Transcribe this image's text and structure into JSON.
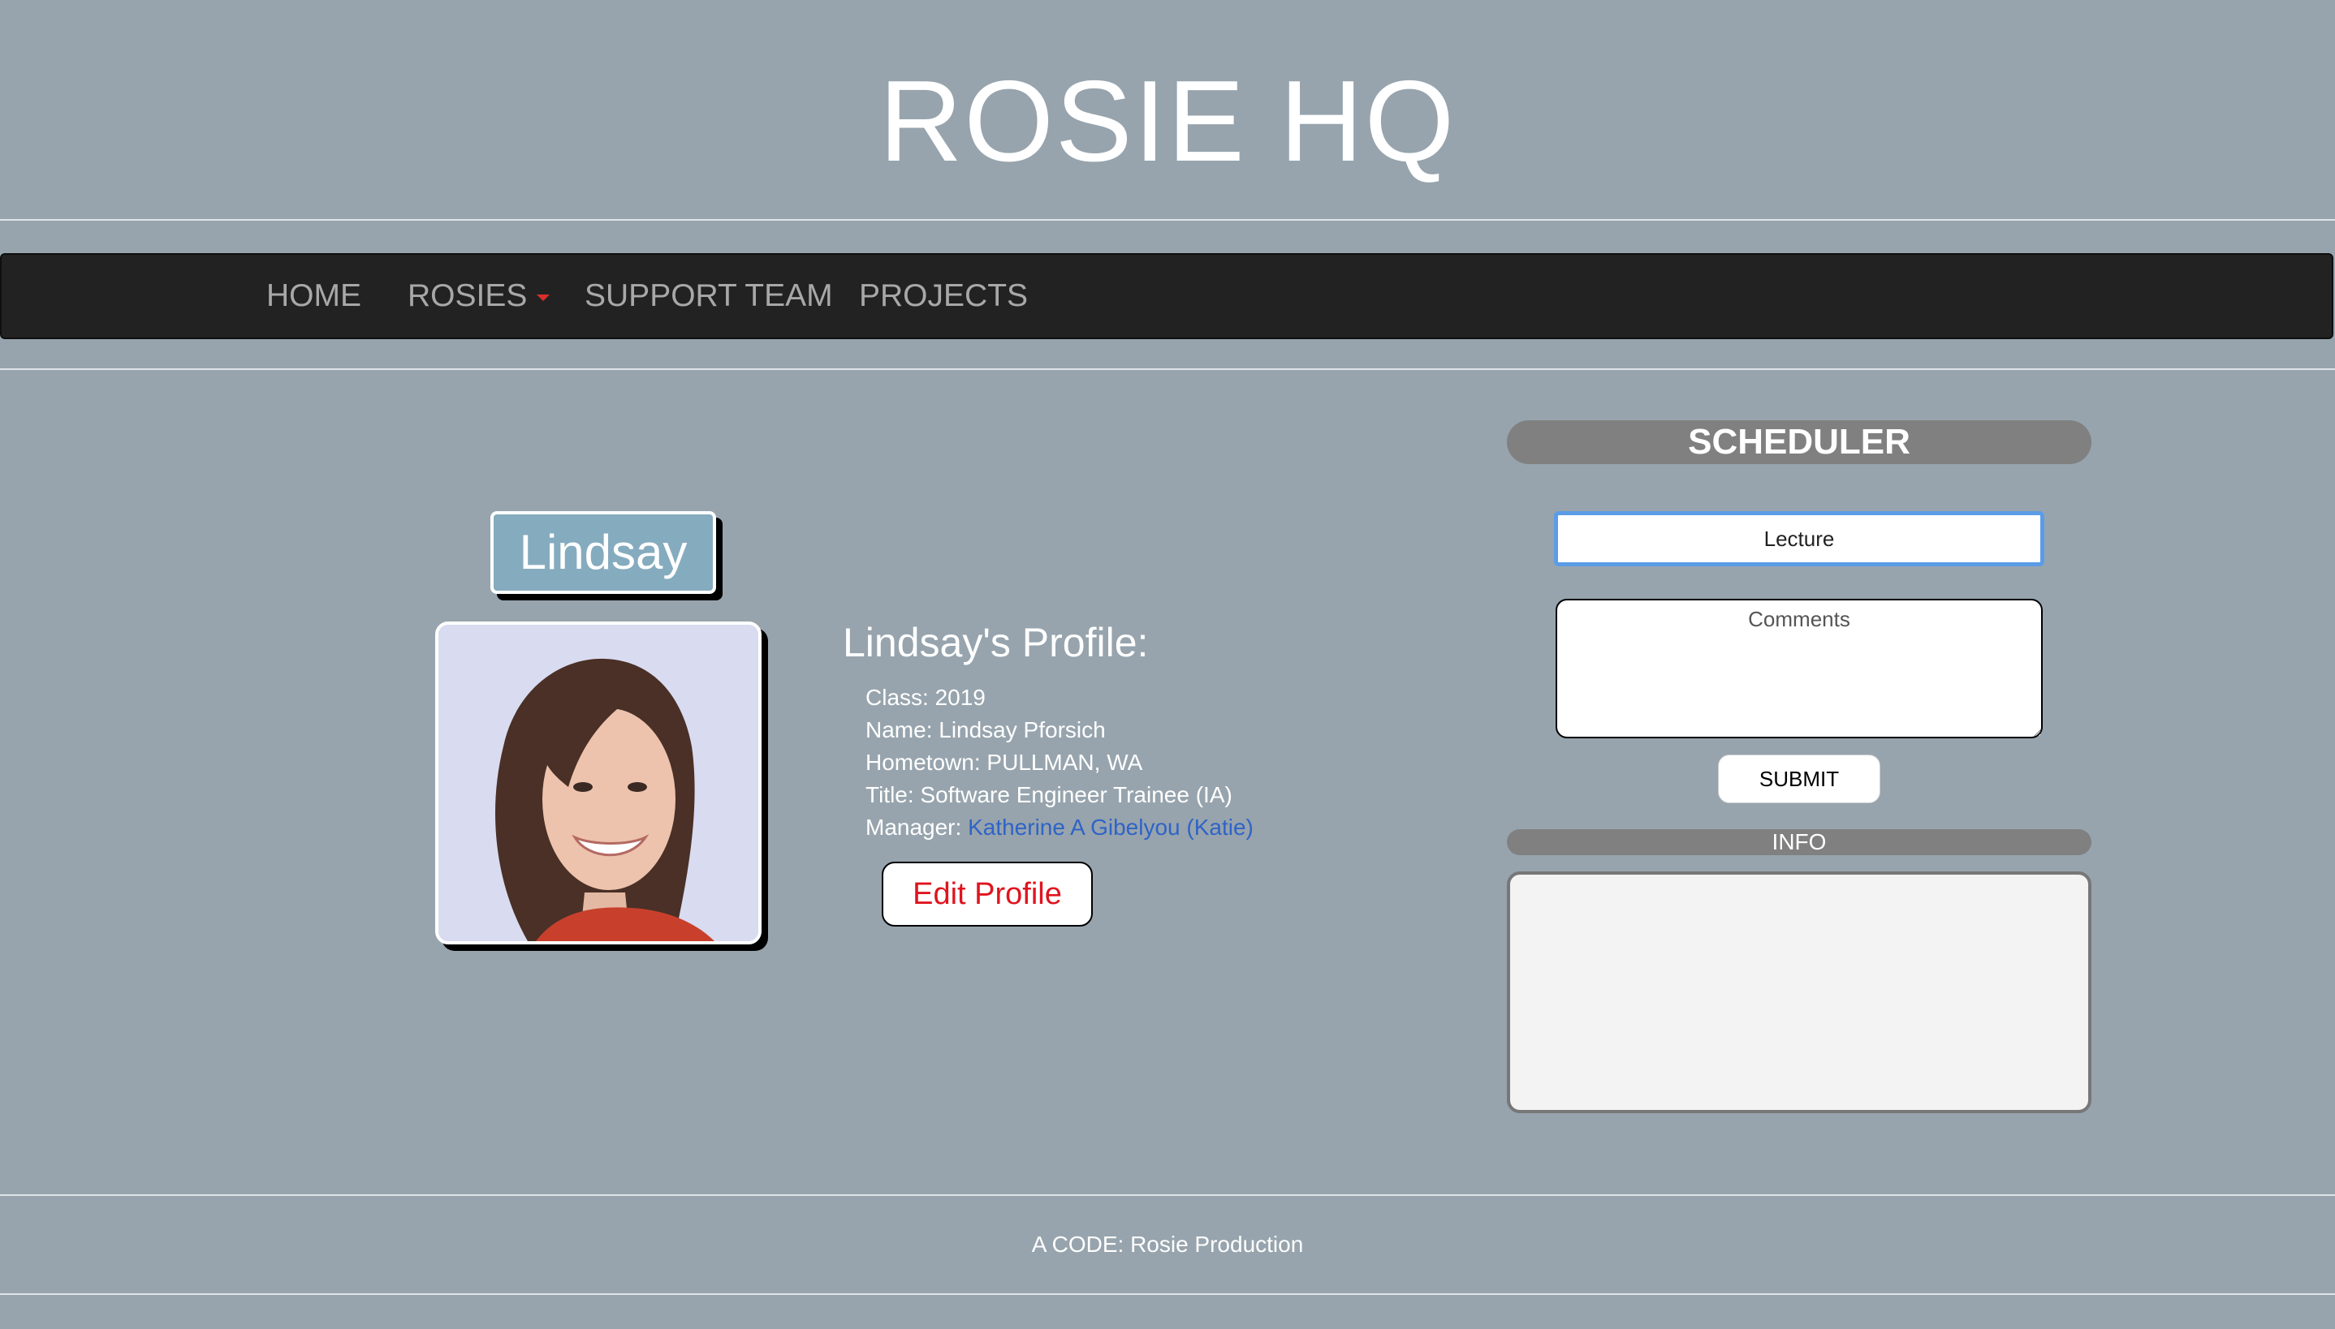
{
  "site": {
    "title": "ROSIE HQ"
  },
  "nav": {
    "items": [
      {
        "label": "HOME"
      },
      {
        "label": "ROSIES",
        "has_dropdown": true
      },
      {
        "label": "SUPPORT TEAM"
      },
      {
        "label": "PROJECTS"
      }
    ]
  },
  "profile": {
    "name_badge": "Lindsay",
    "heading": "Lindsay's Profile:",
    "class_line": "Class: 2019",
    "name_line": "Name: Lindsay Pforsich",
    "hometown_line": "Hometown: PULLMAN, WA",
    "title_line": "Title: Software Engineer Trainee (IA)",
    "manager_label": "Manager: ",
    "manager_name": "Katherine A Gibelyou (Katie)",
    "edit_button": "Edit Profile"
  },
  "scheduler": {
    "header": "SCHEDULER",
    "lecture_value": "Lecture",
    "comments_placeholder": "Comments",
    "submit_label": "SUBMIT",
    "info_header": "INFO",
    "info_text": ""
  },
  "footer": {
    "text": "A CODE: Rosie Production"
  },
  "colors": {
    "background": "#97a4ad",
    "navbar": "#222222",
    "name_badge": "#85abbf",
    "link": "#2f63c7",
    "edit_text": "#e0141e",
    "pill_header": "#808080",
    "focus_ring": "#5b9ce6"
  },
  "icons": {
    "dropdown": "caret-down-icon"
  }
}
